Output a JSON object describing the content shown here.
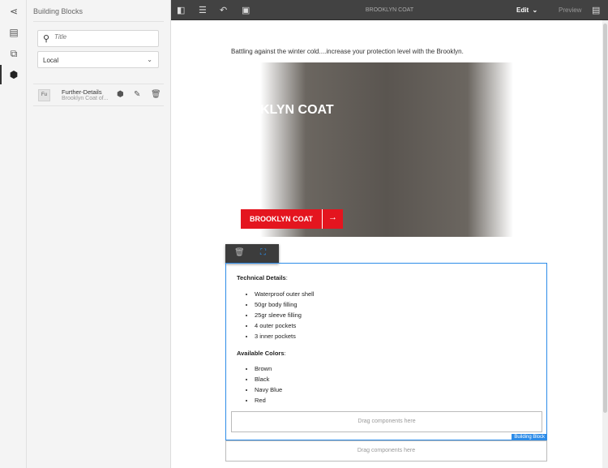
{
  "rail": {
    "icons": [
      "share-icon",
      "layers-icon",
      "assets-icon",
      "building-blocks-icon"
    ]
  },
  "panel": {
    "title": "Building Blocks",
    "search_placeholder": "Title",
    "filter": "Local",
    "items": [
      {
        "badge": "Fu",
        "name": "Further-Details",
        "desc": "Brooklyn Coat of..."
      }
    ]
  },
  "topbar": {
    "title": "BROOKLYN COAT",
    "mode": "Edit",
    "preview": "Preview"
  },
  "page": {
    "intro": "Battling against the winter cold....increase your protection level with the Brooklyn.",
    "hero_text": "KLYN COAT",
    "cta": "BROOKLYN COAT",
    "tech_heading": "Technical Details",
    "tech_items": [
      "Waterproof outer shell",
      "50gr body filling",
      "25gr sleeve filling",
      "4 outer pockets",
      "3 inner pockets"
    ],
    "colors_heading": "Available Colors",
    "colors_items": [
      "Brown",
      "Black",
      "Navy Blue",
      "Red"
    ],
    "drop_inner": "Drag components here",
    "drop_outer": "Drag components here",
    "block_tag": "Building Block"
  }
}
